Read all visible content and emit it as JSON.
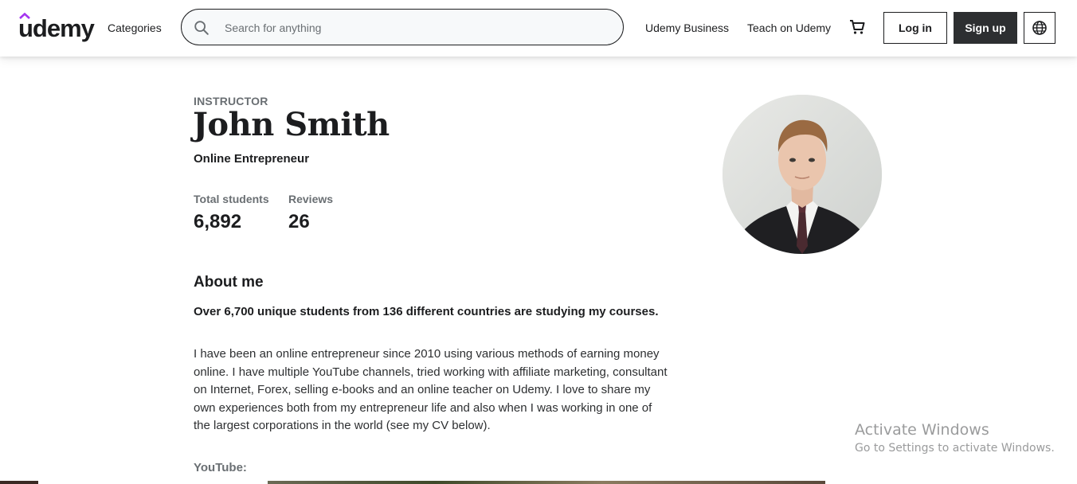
{
  "header": {
    "logo_text": "udemy",
    "brand_color": "#a435f0",
    "categories_label": "Categories",
    "search_placeholder": "Search for anything",
    "search_icon": "search-icon",
    "udemy_business_label": "Udemy Business",
    "teach_label": "Teach on Udemy",
    "cart_icon": "cart-icon",
    "login_label": "Log in",
    "signup_label": "Sign up",
    "language_icon": "globe-icon"
  },
  "profile": {
    "eyebrow": "INSTRUCTOR",
    "name": "John Smith",
    "headline": "Online Entrepreneur",
    "stats": [
      {
        "label": "Total students",
        "value": "6,892"
      },
      {
        "label": "Reviews",
        "value": "26"
      }
    ],
    "about_title": "About me",
    "bio_bold": "Over 6,700 unique students from 136 different countries are studying my courses.",
    "bio_text": "I have been an online entrepreneur since 2010 using various methods of earning money online. I have multiple YouTube channels, tried working with affiliate marketing, consultant on Internet, Forex, selling e-books and an online teacher on Udemy. I love to share my own experiences both from my entrepreneur life and also when I was working in one of the largest corporations in the world (see my CV below).",
    "youtube_label": "YouTube:"
  },
  "watermark": {
    "title": "Activate Windows",
    "subtitle": "Go to Settings to activate Windows."
  }
}
